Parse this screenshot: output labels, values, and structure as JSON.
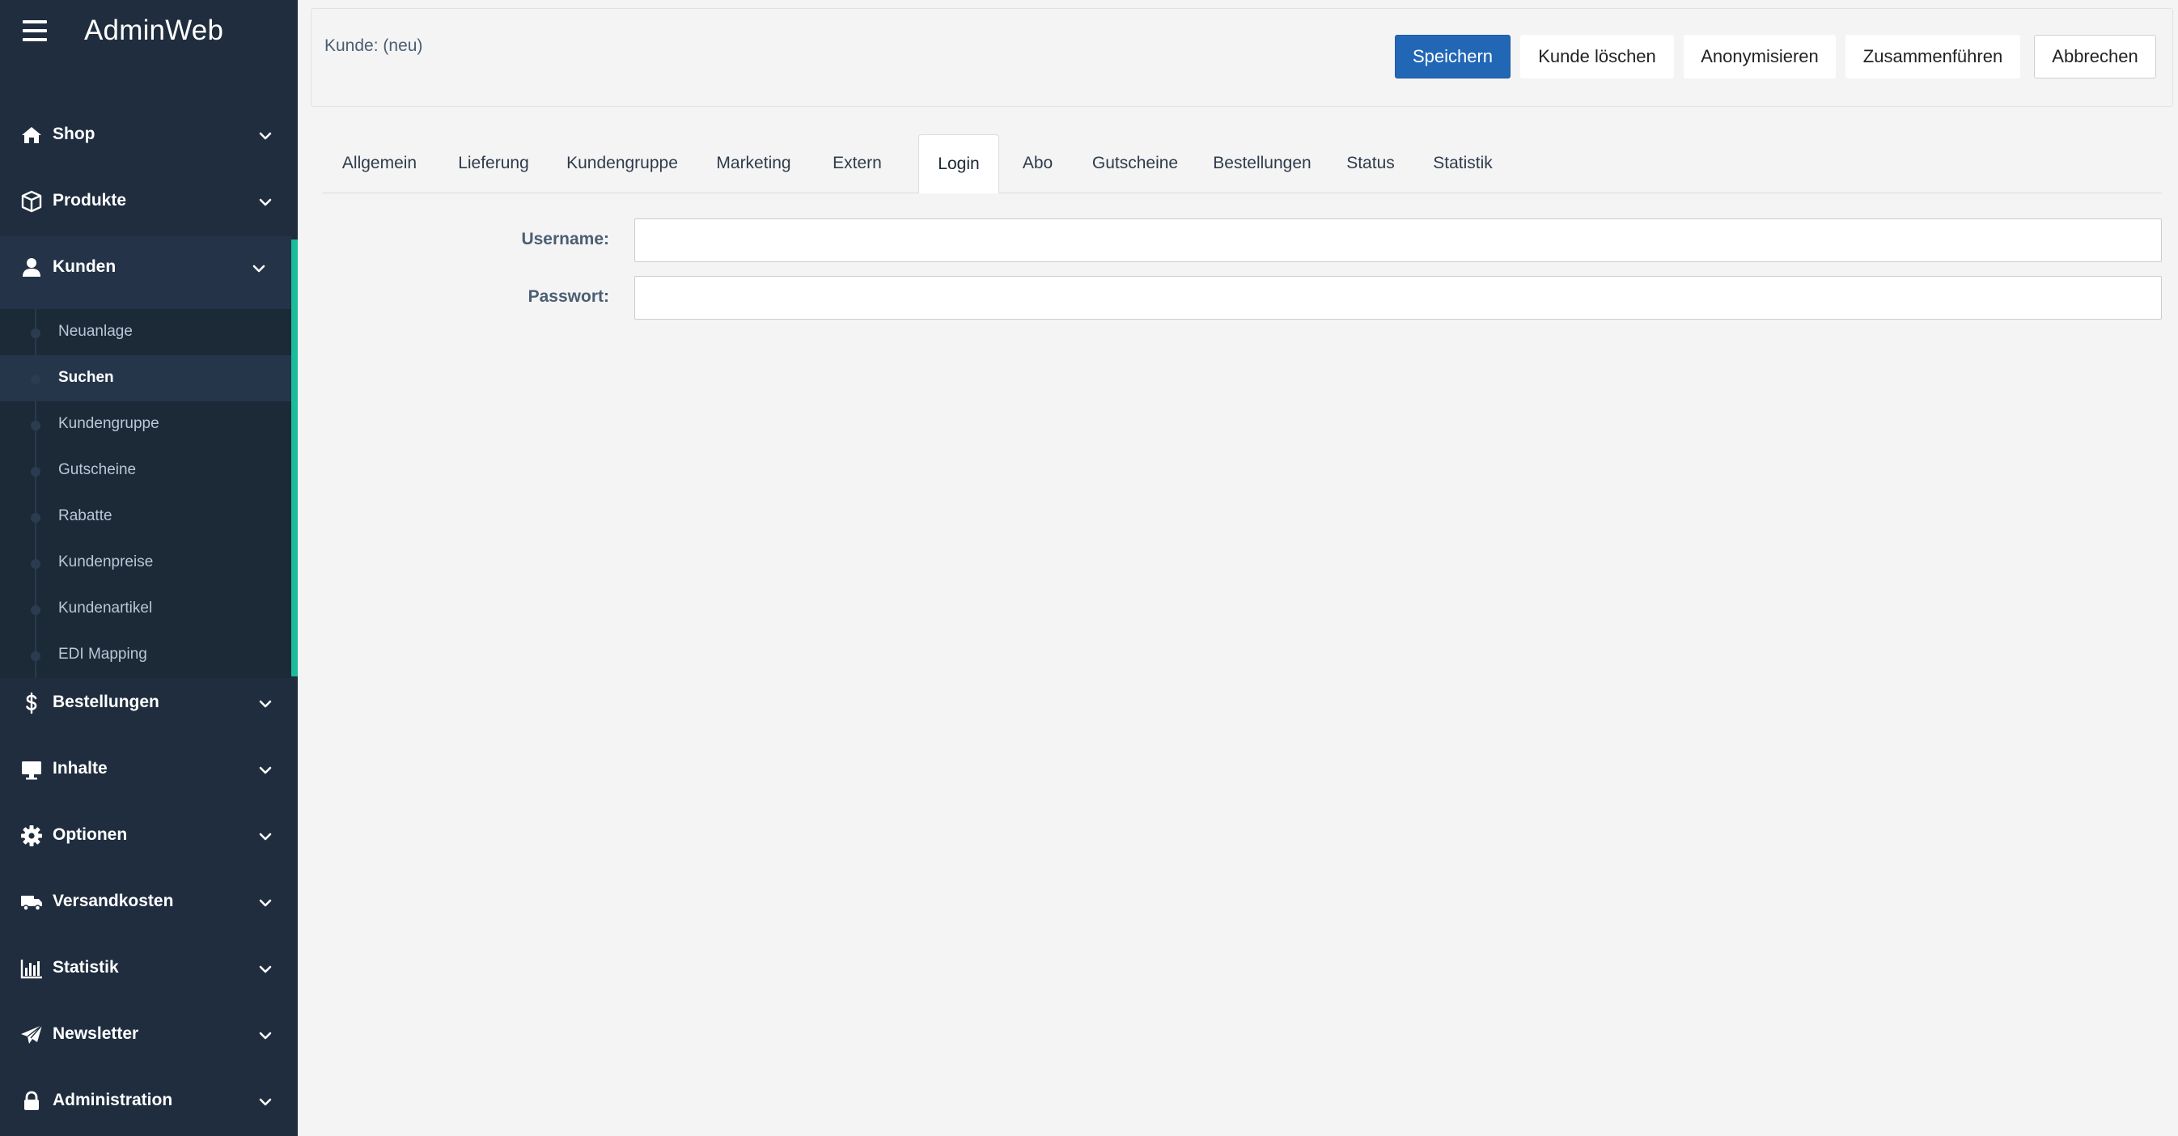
{
  "app": {
    "title": "AdminWeb"
  },
  "sidebar": {
    "menu_icon": "hamburger-icon",
    "items": [
      {
        "label": "Shop",
        "icon": "home-icon"
      },
      {
        "label": "Produkte",
        "icon": "box-icon"
      },
      {
        "label": "Kunden",
        "icon": "user-icon",
        "expanded": true
      },
      {
        "label": "Bestellungen",
        "icon": "dollar-icon"
      },
      {
        "label": "Inhalte",
        "icon": "monitor-icon"
      },
      {
        "label": "Optionen",
        "icon": "gear-icon"
      },
      {
        "label": "Versandkosten",
        "icon": "truck-icon"
      },
      {
        "label": "Statistik",
        "icon": "bar-chart-icon"
      },
      {
        "label": "Newsletter",
        "icon": "paper-plane-icon"
      },
      {
        "label": "Administration",
        "icon": "lock-icon"
      }
    ],
    "kunden_submenu": [
      {
        "label": "Neuanlage"
      },
      {
        "label": "Suchen",
        "active": true
      },
      {
        "label": "Kundengruppe"
      },
      {
        "label": "Gutscheine"
      },
      {
        "label": "Rabatte"
      },
      {
        "label": "Kundenpreise"
      },
      {
        "label": "Kundenartikel"
      },
      {
        "label": "EDI Mapping"
      }
    ],
    "accent_color": "#1abc9c"
  },
  "header": {
    "title": "Kunde: (neu)",
    "buttons": {
      "save": "Speichern",
      "delete": "Kunde löschen",
      "anonymize": "Anonymisieren",
      "merge": "Zusammenführen",
      "cancel": "Abbrechen"
    },
    "primary_color": "#2267b6"
  },
  "tabs": [
    {
      "label": "Allgemein"
    },
    {
      "label": "Lieferung"
    },
    {
      "label": "Kundengruppe"
    },
    {
      "label": "Marketing"
    },
    {
      "label": "Extern"
    },
    {
      "label": "Login",
      "active": true
    },
    {
      "label": "Abo"
    },
    {
      "label": "Gutscheine"
    },
    {
      "label": "Bestellungen"
    },
    {
      "label": "Status"
    },
    {
      "label": "Statistik"
    }
  ],
  "form": {
    "username": {
      "label": "Username:",
      "value": "",
      "placeholder": ""
    },
    "password": {
      "label": "Passwort:",
      "value": "",
      "placeholder": ""
    }
  }
}
